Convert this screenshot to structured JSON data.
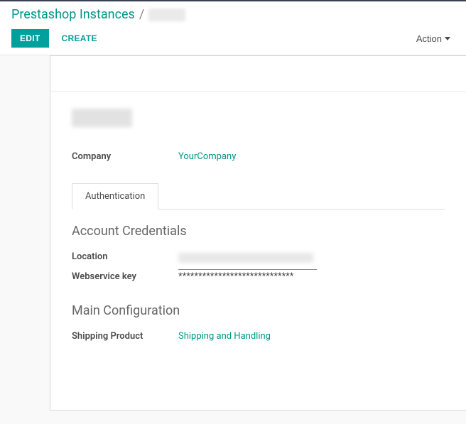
{
  "breadcrumb": {
    "root": "Prestashop Instances",
    "separator": "/"
  },
  "toolbar": {
    "edit_label": "Edit",
    "create_label": "Create",
    "action_label": "Action"
  },
  "form": {
    "company_label": "Company",
    "company_value": "YourCompany",
    "tabs": {
      "authentication": "Authentication"
    },
    "sections": {
      "account_credentials": "Account Credentials",
      "main_configuration": "Main Configuration"
    },
    "location_label": "Location",
    "webservice_key_label": "Webservice key",
    "webservice_key_value": "*****************************",
    "shipping_product_label": "Shipping Product",
    "shipping_product_value": "Shipping and Handling"
  }
}
